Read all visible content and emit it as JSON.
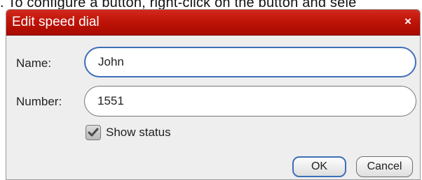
{
  "background": {
    "instruction_text": ". To configure a button, right-click on the button and sele"
  },
  "dialog": {
    "title": "Edit speed dial",
    "close_glyph": "×",
    "name_label": "Name:",
    "name_value": "John",
    "number_label": "Number:",
    "number_value": "1551",
    "show_status_label": "Show status",
    "show_status_checked": true,
    "ok_label": "OK",
    "cancel_label": "Cancel",
    "colors": {
      "titlebar": "#c01408",
      "focus_border": "#3d6fb8"
    },
    "icons": {
      "close": "close-icon",
      "check": "checkmark-icon"
    }
  }
}
